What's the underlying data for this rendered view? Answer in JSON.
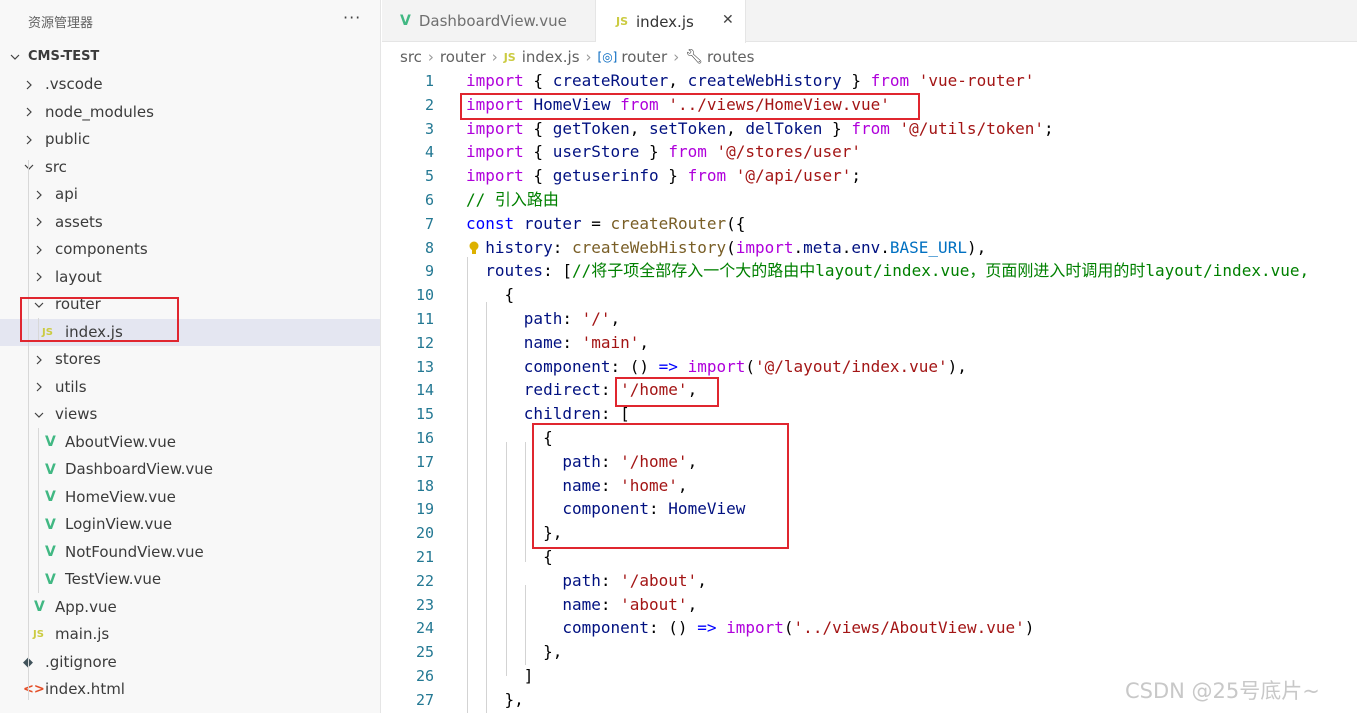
{
  "explorer": {
    "title": "资源管理器",
    "more": "···",
    "project": "CMS-TEST",
    "items": [
      {
        "label": ".vscode",
        "type": "folder"
      },
      {
        "label": "node_modules",
        "type": "folder"
      },
      {
        "label": "public",
        "type": "folder"
      },
      {
        "label": "src",
        "type": "folder-open"
      },
      {
        "label": "api",
        "type": "folder"
      },
      {
        "label": "assets",
        "type": "folder"
      },
      {
        "label": "components",
        "type": "folder"
      },
      {
        "label": "layout",
        "type": "folder"
      },
      {
        "label": "router",
        "type": "folder-open"
      },
      {
        "label": "index.js",
        "type": "js"
      },
      {
        "label": "stores",
        "type": "folder"
      },
      {
        "label": "utils",
        "type": "folder"
      },
      {
        "label": "views",
        "type": "folder-open"
      },
      {
        "label": "AboutView.vue",
        "type": "vue"
      },
      {
        "label": "DashboardView.vue",
        "type": "vue"
      },
      {
        "label": "HomeView.vue",
        "type": "vue"
      },
      {
        "label": "LoginView.vue",
        "type": "vue"
      },
      {
        "label": "NotFoundView.vue",
        "type": "vue"
      },
      {
        "label": "TestView.vue",
        "type": "vue"
      },
      {
        "label": "App.vue",
        "type": "vue"
      },
      {
        "label": "main.js",
        "type": "js"
      },
      {
        "label": ".gitignore",
        "type": "git"
      },
      {
        "label": "index.html",
        "type": "html"
      }
    ]
  },
  "tabs": [
    {
      "label": "DashboardView.vue",
      "icon": "V",
      "active": false
    },
    {
      "label": "index.js",
      "icon": "JS",
      "active": true,
      "close": "✕"
    }
  ],
  "breadcrumb": [
    "src",
    "router",
    "index.js",
    "router",
    "routes"
  ],
  "code_lines": [
    "import { createRouter, createWebHistory } from 'vue-router'",
    "import HomeView from '../views/HomeView.vue'",
    "import { getToken, setToken, delToken } from '@/utils/token';",
    "import { userStore } from '@/stores/user'",
    "import { getuserinfo } from '@/api/user';",
    "// 引入路由",
    "const router = createRouter({",
    "  history: createWebHistory(import.meta.env.BASE_URL),",
    "  routes: [//将子项全部存入一个大的路由中layout/index.vue，页面刚进入时调用的时layout/index.vue,",
    "    {",
    "      path: '/',",
    "      name: 'main',",
    "      component: () => import('@/layout/index.vue'),",
    "      redirect: '/home',",
    "      children: [",
    "        {",
    "          path: '/home',",
    "          name: 'home',",
    "          component: HomeView",
    "        },",
    "        {",
    "          path: '/about',",
    "          name: 'about',",
    "          component: () => import('../views/AboutView.vue')",
    "        },",
    "      ]",
    "    },"
  ],
  "watermark": "CSDN @25号底片~",
  "colors": {
    "keyword": "#af00db",
    "string": "#a31515",
    "function": "#795e26",
    "variable": "#001080",
    "comment": "#008000",
    "annotation": "#e0262f"
  }
}
